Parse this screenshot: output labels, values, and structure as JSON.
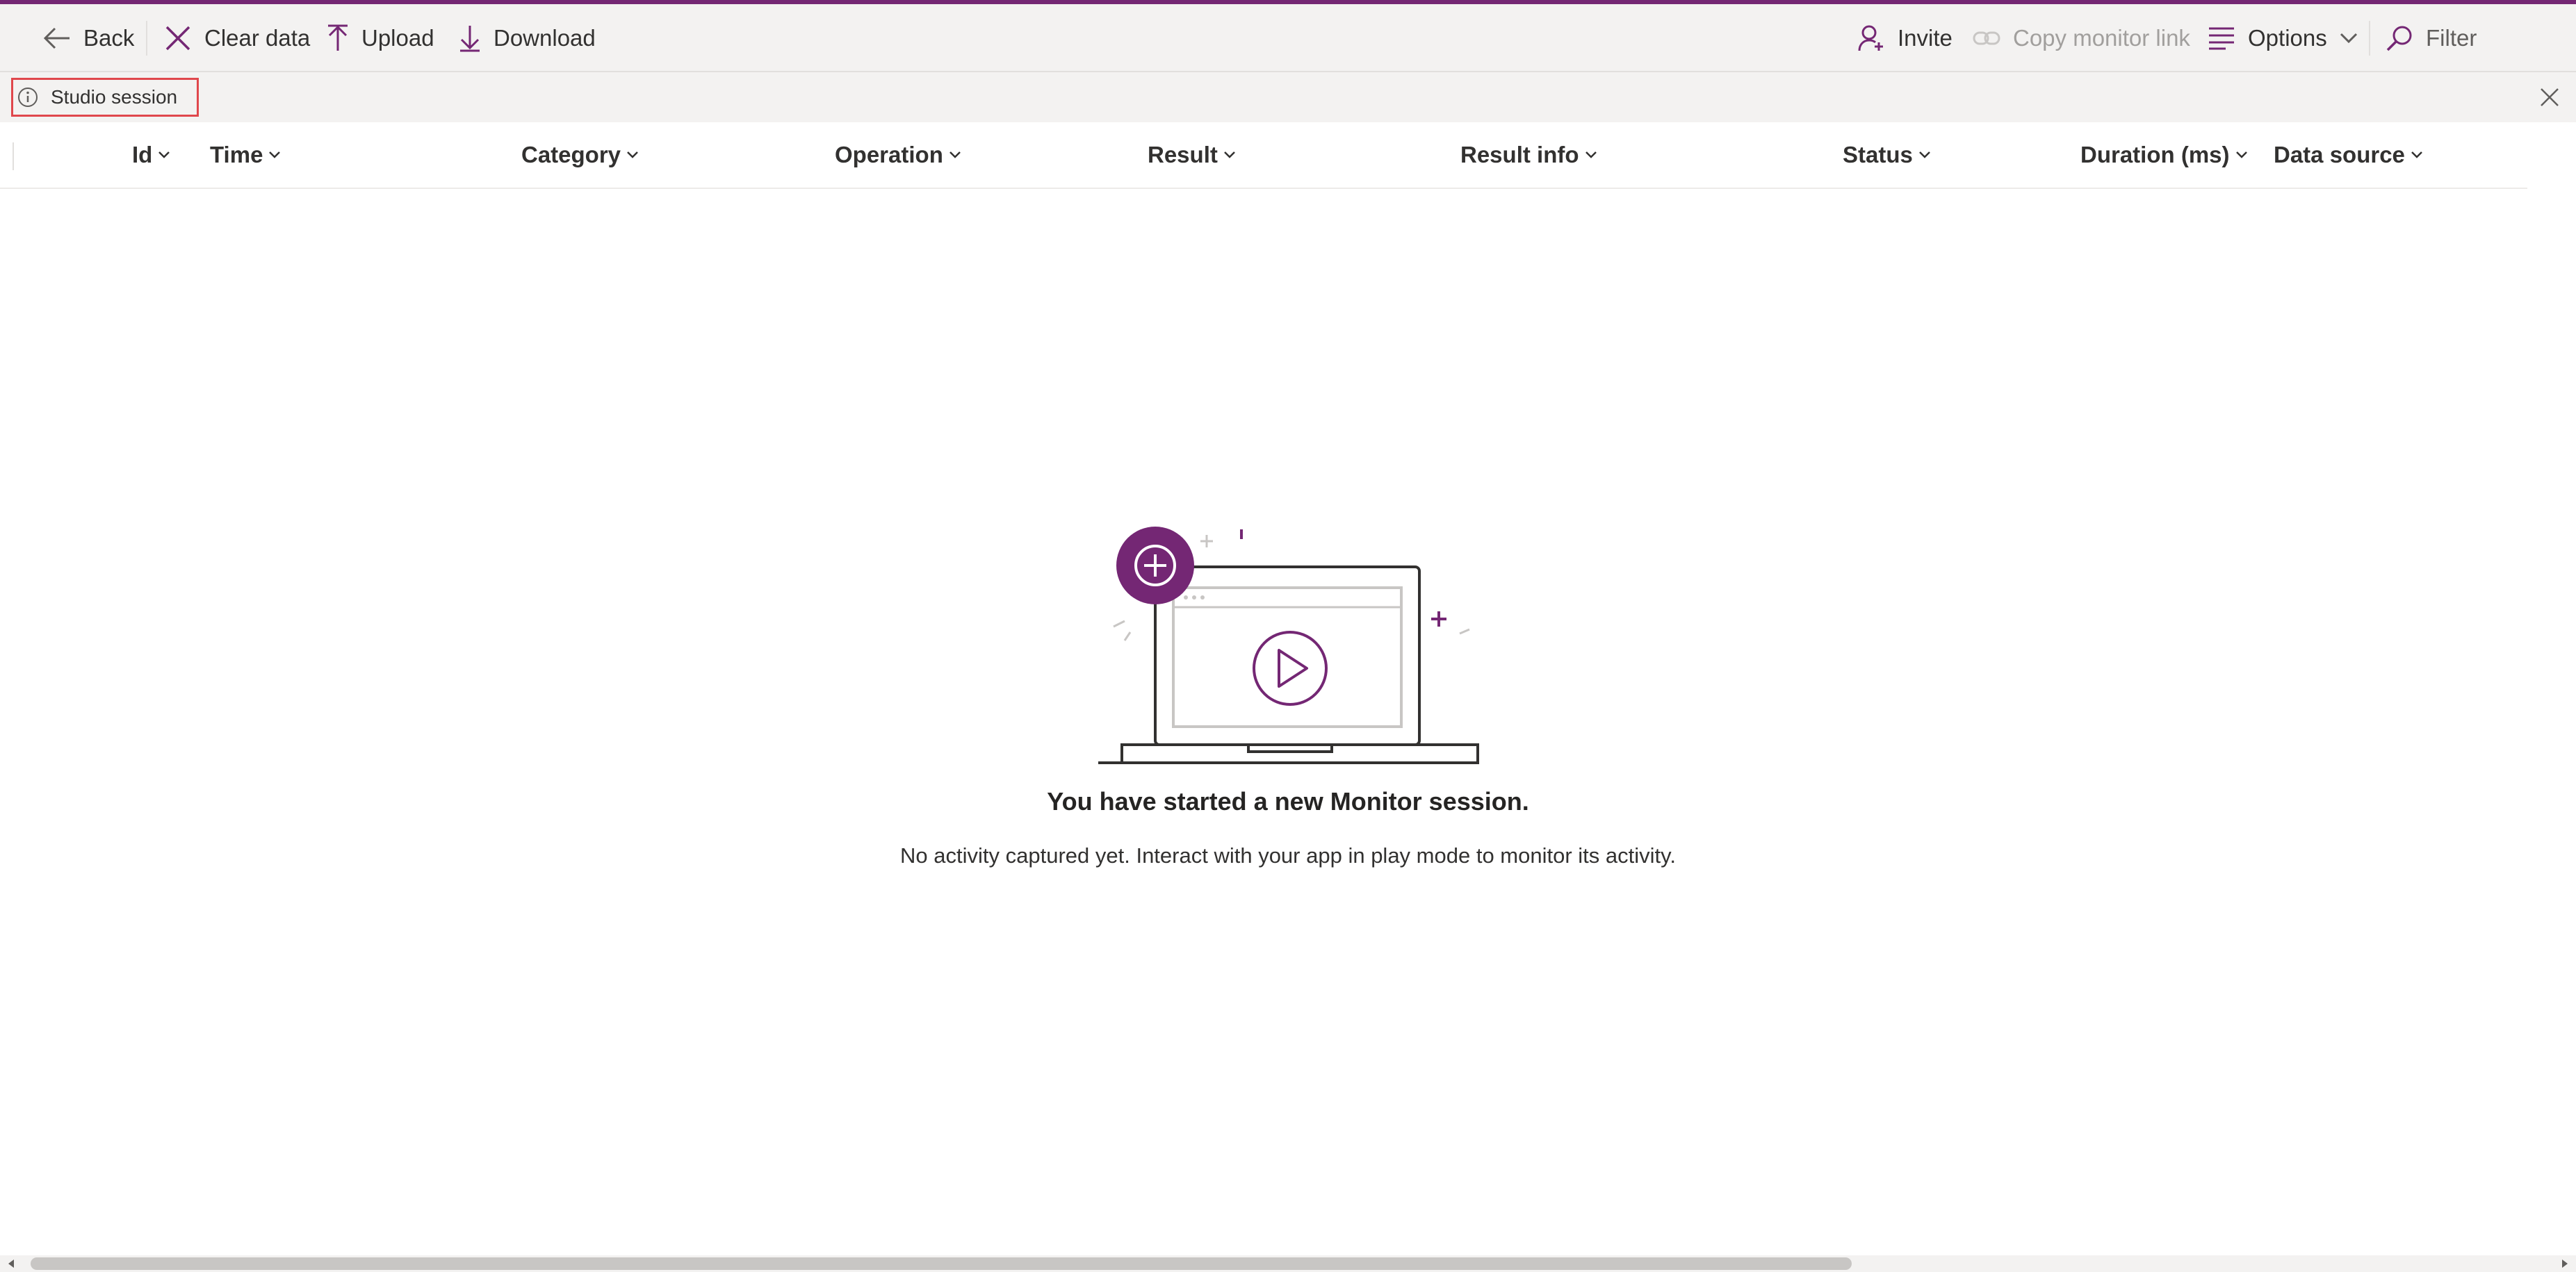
{
  "toolbar": {
    "back_label": "Back",
    "clear_label": "Clear data",
    "upload_label": "Upload",
    "download_label": "Download",
    "invite_label": "Invite",
    "copy_link_label": "Copy monitor link",
    "options_label": "Options",
    "filter_label": "Filter"
  },
  "infobar": {
    "session_label": "Studio session"
  },
  "table": {
    "columns": [
      "Id",
      "Time",
      "Category",
      "Operation",
      "Result",
      "Result info",
      "Status",
      "Duration (ms)",
      "Data source"
    ]
  },
  "empty_state": {
    "title": "You have started a new Monitor session.",
    "subtitle": "No activity captured yet. Interact with your app in play mode to monitor its activity."
  },
  "colors": {
    "accent": "#742774",
    "highlight_border": "#e0474c"
  }
}
